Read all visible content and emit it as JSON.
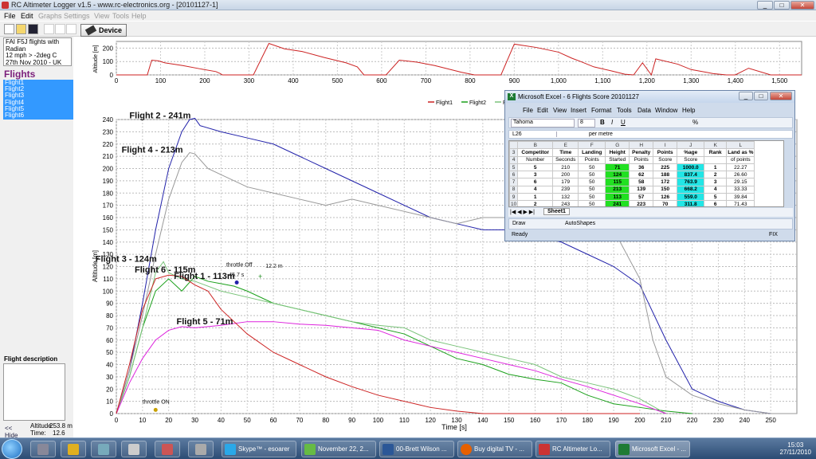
{
  "window": {
    "title": "RC Altimeter Logger v1.5  -  www.rc-electronics.org  - [20101127-1]"
  },
  "menu": [
    "File",
    "Edit",
    "Graphs",
    "Settings",
    "View",
    "Tools",
    "Help"
  ],
  "toolbar": {
    "device_label": "Device"
  },
  "info": {
    "line1": "FAI F5J flights with Radian",
    "line2": "12 mph  >  -2deg C",
    "line3": "27th Nov 2010 - UK"
  },
  "flights": {
    "heading": "Flights",
    "items": [
      "Flight1",
      "Flight2",
      "Flight3",
      "Flight4",
      "Flight5",
      "Flight6"
    ]
  },
  "description": {
    "heading": "Flight description"
  },
  "bottom": {
    "hide": "<< Hide",
    "altitude_label": "Altitude:",
    "altitude_value": "253.8 m",
    "time_label": "Time:",
    "time_value": "12.6 s"
  },
  "colors": {
    "flight1": "#1aa01a",
    "flight2": "#2222aa",
    "flight3": "#7ac37a",
    "flight4": "#999999",
    "flight5": "#dd22dd",
    "flight6": "#cc2222"
  },
  "chart_data": [
    {
      "type": "line",
      "ylabel": "Altitude [m]",
      "xlim": [
        0,
        1550
      ],
      "ylim": [
        0,
        250
      ],
      "xticks": [
        0,
        100,
        200,
        300,
        400,
        500,
        600,
        700,
        800,
        900,
        "1,000",
        "1,100",
        "1,200",
        "1,300",
        "1,400",
        "1,500"
      ],
      "yticks": [
        0,
        100,
        200
      ],
      "series": [
        {
          "name": "",
          "x": [
            0,
            70,
            80,
            95,
            110,
            150,
            190,
            225,
            235,
            240,
            310,
            345,
            380,
            420,
            470,
            520,
            545,
            560,
            610,
            640,
            680,
            720,
            780,
            810,
            830,
            870,
            900,
            950,
            1000,
            1030,
            1050,
            1080,
            1120,
            1150,
            1170,
            1190,
            1210,
            1220,
            1270,
            1300,
            1350,
            1380,
            1400,
            1430,
            1480,
            1520,
            1550
          ],
          "y": [
            0,
            0,
            110,
            105,
            90,
            70,
            45,
            25,
            10,
            0,
            0,
            235,
            195,
            175,
            130,
            90,
            60,
            0,
            0,
            110,
            95,
            70,
            20,
            0,
            0,
            0,
            230,
            205,
            170,
            125,
            100,
            60,
            30,
            5,
            0,
            90,
            0,
            120,
            80,
            40,
            10,
            0,
            0,
            50,
            0,
            0,
            0
          ]
        }
      ],
      "legend": [
        "Flight1",
        "Flight2",
        "Flight3"
      ]
    },
    {
      "type": "line",
      "xlabel": "Time [s]",
      "ylabel": "Altitude [m]",
      "xlim": [
        0,
        260
      ],
      "ylim": [
        0,
        240
      ],
      "xticks": [
        0,
        10,
        20,
        30,
        40,
        50,
        60,
        70,
        80,
        90,
        100,
        110,
        120,
        130,
        140,
        150,
        160,
        170,
        180,
        190,
        200,
        210,
        220,
        230,
        240,
        250
      ],
      "yticks": [
        0,
        10,
        20,
        30,
        40,
        50,
        60,
        70,
        80,
        90,
        100,
        110,
        120,
        130,
        140,
        150,
        160,
        170,
        180,
        190,
        200,
        210,
        220,
        230,
        240
      ],
      "series": [
        {
          "name": "Flight1",
          "x": [
            0,
            5,
            10,
            15,
            20,
            25,
            30,
            35,
            40,
            45,
            50,
            60,
            70,
            80,
            90,
            100,
            110,
            120,
            130,
            140,
            150,
            160,
            170,
            180,
            190,
            200,
            210,
            220
          ],
          "y": [
            0,
            30,
            70,
            100,
            110,
            100,
            112,
            108,
            106,
            104,
            100,
            90,
            85,
            80,
            75,
            70,
            65,
            55,
            45,
            40,
            32,
            28,
            25,
            15,
            8,
            5,
            2,
            0
          ]
        },
        {
          "name": "Flight2",
          "x": [
            0,
            5,
            10,
            15,
            20,
            25,
            28,
            30,
            32,
            40,
            50,
            60,
            70,
            80,
            90,
            100,
            110,
            120,
            130,
            140,
            150,
            160,
            170,
            180,
            190,
            200,
            210,
            220,
            230,
            240,
            250,
            260
          ],
          "y": [
            0,
            35,
            90,
            150,
            200,
            230,
            240,
            241,
            235,
            230,
            225,
            220,
            210,
            200,
            190,
            180,
            170,
            160,
            155,
            150,
            150,
            145,
            140,
            130,
            120,
            105,
            60,
            20,
            10,
            3,
            0,
            0
          ]
        },
        {
          "name": "Flight3",
          "x": [
            0,
            5,
            10,
            15,
            18,
            20,
            25,
            30,
            40,
            50,
            60,
            70,
            80,
            90,
            100,
            110,
            120,
            130,
            140,
            150,
            160,
            170,
            180,
            190,
            200,
            210
          ],
          "y": [
            0,
            30,
            70,
            115,
            124,
            115,
            110,
            108,
            100,
            95,
            90,
            85,
            80,
            75,
            72,
            70,
            60,
            55,
            50,
            45,
            40,
            30,
            25,
            20,
            12,
            0
          ]
        },
        {
          "name": "Flight4",
          "x": [
            0,
            5,
            10,
            15,
            20,
            25,
            28,
            30,
            35,
            40,
            50,
            60,
            70,
            80,
            90,
            100,
            110,
            120,
            130,
            140,
            150,
            160,
            170,
            180,
            190,
            200,
            205,
            210,
            220,
            230,
            240,
            250,
            260
          ],
          "y": [
            0,
            35,
            80,
            130,
            175,
            205,
            213,
            212,
            200,
            195,
            185,
            180,
            175,
            170,
            175,
            170,
            165,
            160,
            155,
            160,
            160,
            165,
            168,
            170,
            150,
            110,
            60,
            30,
            15,
            8,
            3,
            0,
            0
          ]
        },
        {
          "name": "Flight5",
          "x": [
            0,
            5,
            10,
            15,
            20,
            25,
            30,
            40,
            50,
            60,
            70,
            80,
            90,
            100,
            110,
            120,
            130,
            140,
            150,
            160,
            170,
            180,
            190,
            200,
            210
          ],
          "y": [
            0,
            25,
            45,
            60,
            68,
            71,
            70,
            72,
            75,
            75,
            73,
            72,
            70,
            68,
            60,
            55,
            50,
            45,
            40,
            35,
            28,
            22,
            15,
            8,
            0
          ]
        },
        {
          "name": "Flight6",
          "x": [
            0,
            5,
            10,
            15,
            20,
            25,
            30,
            35,
            40,
            45,
            50,
            60,
            70,
            80,
            90,
            100,
            110,
            120,
            130,
            140,
            150,
            160,
            170,
            180,
            190,
            200
          ],
          "y": [
            0,
            40,
            85,
            110,
            113,
            112,
            105,
            100,
            85,
            75,
            65,
            50,
            40,
            30,
            22,
            15,
            10,
            5,
            2,
            0,
            0,
            0,
            0,
            0,
            0,
            0
          ]
        }
      ],
      "annotations": [
        {
          "text": "Flight 2 - 241m",
          "x": 5,
          "y": 241
        },
        {
          "text": "Flight 4 - 213m",
          "x": 2,
          "y": 213
        },
        {
          "text": "Flight 3 - 124m",
          "x": -8,
          "y": 124
        },
        {
          "text": "Flight 6 - 115m",
          "x": 7,
          "y": 115
        },
        {
          "text": "Flight 1 - 113m",
          "x": 22,
          "y": 110
        },
        {
          "text": "Flight 5 - 71m",
          "x": 23,
          "y": 73
        },
        {
          "text": "throttle Off",
          "x": 42,
          "y": 120
        },
        {
          "text": "12.2 m",
          "x": 57,
          "y": 119
        },
        {
          "text": "45.7 s",
          "x": 43,
          "y": 112
        },
        {
          "text": "throttle ON",
          "x": 10,
          "y": 8
        }
      ]
    }
  ],
  "excel": {
    "title": "Microsoft Excel - 6 Flights Score 20101127",
    "menu": [
      "File",
      "Edit",
      "View",
      "Insert",
      "Format",
      "Tools",
      "Data",
      "Window",
      "Help"
    ],
    "font": "Tahoma",
    "size": "8",
    "cell_ref": "L26",
    "formula": "per metre",
    "columns": [
      "B",
      "E",
      "F",
      "G",
      "H",
      "I",
      "J",
      "K",
      "L"
    ],
    "headers1": [
      "Competitor",
      "Time",
      "Landing",
      "Height",
      "Penalty",
      "Points",
      "%age",
      "Rank",
      "Land as %"
    ],
    "headers2": [
      "Number",
      "Seconds",
      "Points",
      "Started",
      "Points",
      "Score",
      "Score",
      "",
      "of points"
    ],
    "rows": [
      {
        "n": "5",
        "cells": [
          "5",
          "210",
          "50",
          "71",
          "36",
          "225",
          "1000.0",
          "1",
          "22.27"
        ]
      },
      {
        "n": "6",
        "cells": [
          "3",
          "200",
          "50",
          "124",
          "62",
          "188",
          "837.4",
          "2",
          "26.60"
        ]
      },
      {
        "n": "7",
        "cells": [
          "6",
          "179",
          "50",
          "115",
          "58",
          "172",
          "763.9",
          "3",
          "29.15"
        ]
      },
      {
        "n": "8",
        "cells": [
          "4",
          "239",
          "50",
          "213",
          "139",
          "150",
          "668.2",
          "4",
          "33.33"
        ]
      },
      {
        "n": "9",
        "cells": [
          "1",
          "132",
          "50",
          "113",
          "57",
          "126",
          "559.0",
          "5",
          "39.84"
        ]
      },
      {
        "n": "10",
        "cells": [
          "2",
          "243",
          "50",
          "241",
          "223",
          "70",
          "311.8",
          "6",
          "71.43"
        ]
      }
    ],
    "row_numbers_header": [
      "3",
      "4"
    ],
    "sheet_tab": "Sheet1",
    "draw": "Draw",
    "autoshapes": "AutoShapes",
    "status": "Ready",
    "fix": "FIX"
  },
  "taskbar": {
    "items": [
      "Skype™ - esoarer",
      "November 22, 2...",
      "00-Brett Wilson ...",
      "Buy digital TV - ...",
      "RC Altimeter Lo...",
      "Microsoft Excel - ..."
    ],
    "time": "15:03",
    "date": "27/11/2010"
  }
}
